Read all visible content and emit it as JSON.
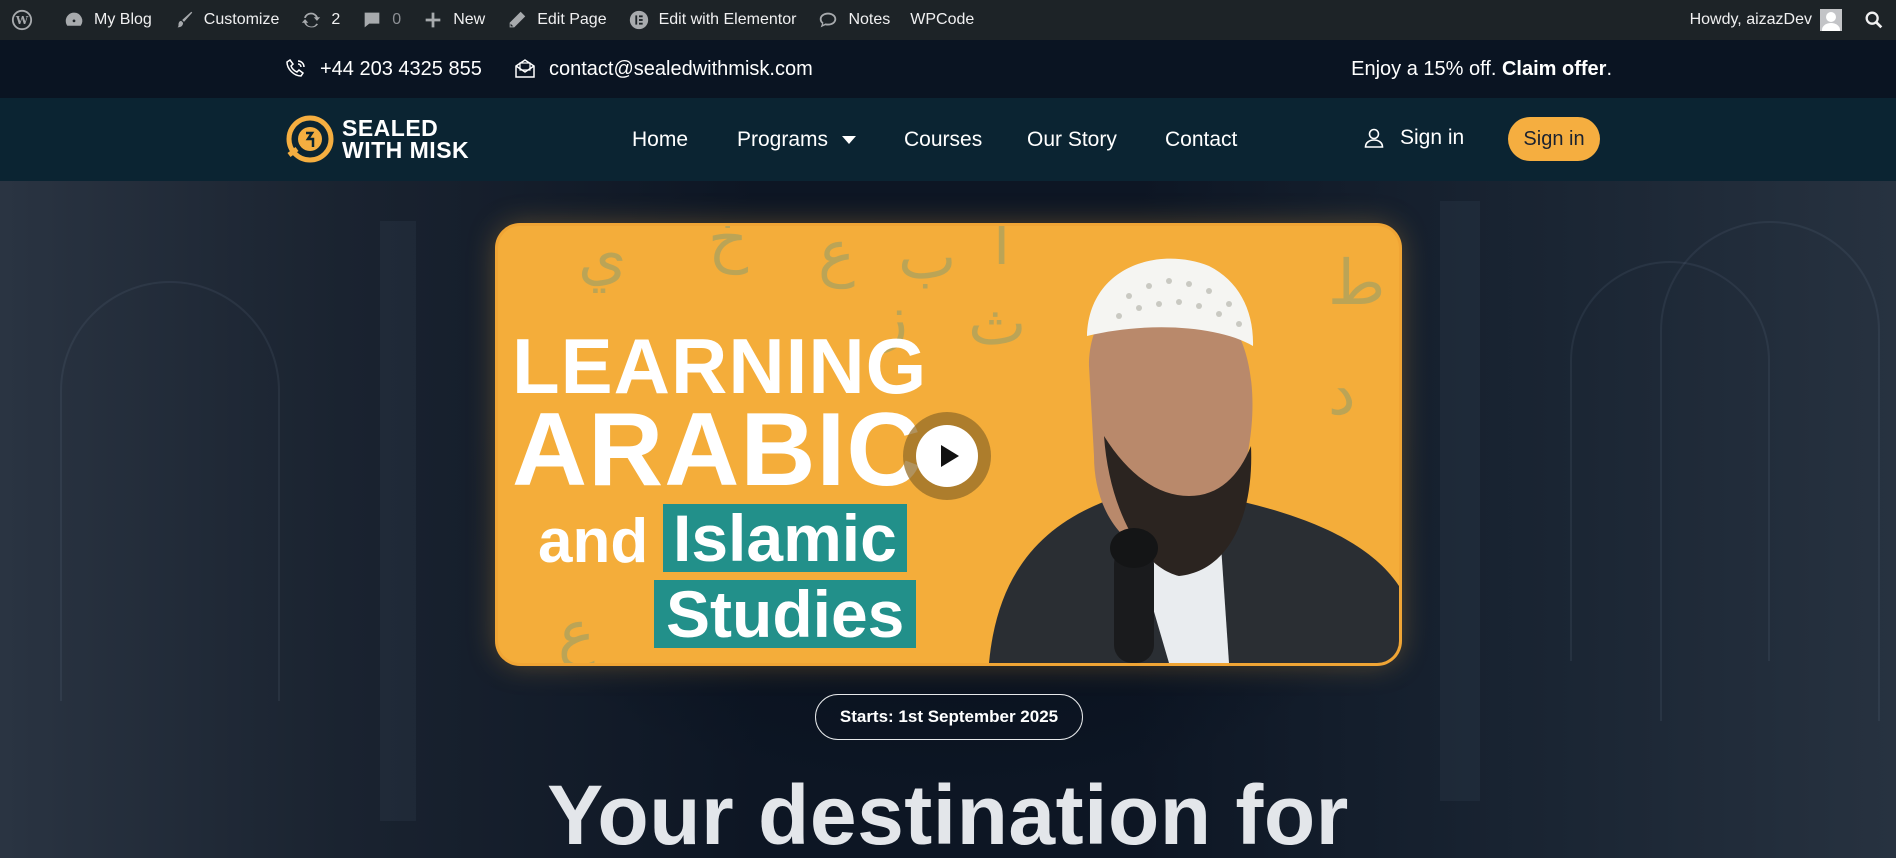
{
  "admin_bar": {
    "my_blog": "My Blog",
    "customize": "Customize",
    "updates_count": "2",
    "comments_count": "0",
    "new": "New",
    "edit_page": "Edit Page",
    "edit_elementor": "Edit with Elementor",
    "notes": "Notes",
    "wpcode": "WPCode",
    "howdy": "Howdy, aizazDev"
  },
  "topbar": {
    "phone": "+44 203 4325 855",
    "email": "contact@sealedwithmisk.com",
    "offer_text": "Enjoy a 15% off.",
    "offer_link": "Claim offer",
    "offer_period": "."
  },
  "header": {
    "logo_line1": "SEALED",
    "logo_line2": "WITH MISK",
    "nav": [
      "Home",
      "Programs",
      "Courses",
      "Our Story",
      "Contact"
    ],
    "signin_link": "Sign in",
    "signin_button": "Sign in",
    "accent_color": "#f5ae40"
  },
  "hero": {
    "video_line1": "LEARNING",
    "video_line2": "ARABIC",
    "video_line3a": "and",
    "video_line3b": "Islamic",
    "video_line4": "Studies",
    "start_badge": "Starts: 1st September 2025",
    "headline": "Your destination for"
  }
}
